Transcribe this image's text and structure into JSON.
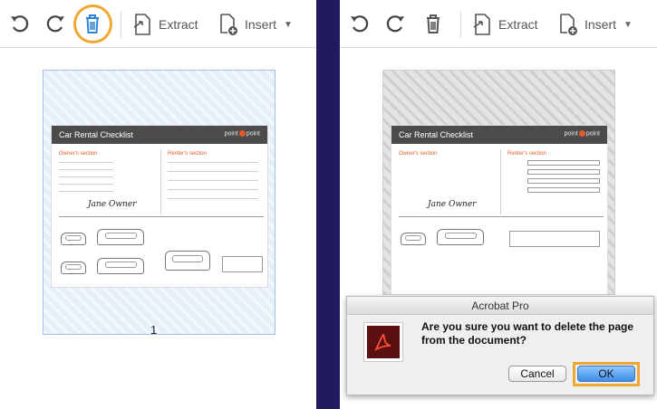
{
  "toolbar": {
    "extract_label": "Extract",
    "insert_label": "Insert",
    "icons": [
      "undo-icon",
      "redo-icon",
      "trash-icon",
      "extract-icon",
      "insert-icon"
    ]
  },
  "thumbnail": {
    "page_number": "1",
    "title": "Car Rental Checklist",
    "logo_left": "point",
    "logo_right": "point",
    "owners_section": "Owner's section",
    "renters_section": "Renter's section"
  },
  "dialog": {
    "title": "Acrobat Pro",
    "message": "Are you sure you want to delete the page from the document?",
    "cancel_label": "Cancel",
    "ok_label": "OK"
  },
  "colors": {
    "divider": "#1f1b5e",
    "highlight": "#f0a833",
    "accent": "#e8592b",
    "selection": "#e6f0fb"
  }
}
